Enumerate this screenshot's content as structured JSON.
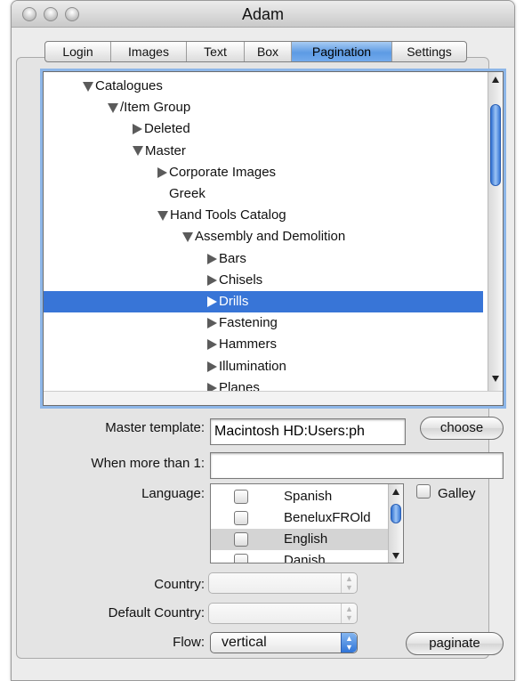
{
  "window": {
    "title": "Adam"
  },
  "tabs": [
    {
      "label": "Login",
      "active": false
    },
    {
      "label": "Images",
      "active": false
    },
    {
      "label": "Text",
      "active": false
    },
    {
      "label": "Box",
      "active": false
    },
    {
      "label": "Pagination",
      "active": true
    },
    {
      "label": "Settings",
      "active": false
    }
  ],
  "tree": {
    "items": [
      {
        "label": "Catalogues",
        "expanded": true,
        "level": 0,
        "has_children": true
      },
      {
        "label": "/Item Group",
        "expanded": true,
        "level": 1,
        "has_children": true
      },
      {
        "label": "Deleted",
        "expanded": false,
        "level": 2,
        "has_children": true
      },
      {
        "label": "Master",
        "expanded": true,
        "level": 2,
        "has_children": true
      },
      {
        "label": "Corporate Images",
        "expanded": false,
        "level": 3,
        "has_children": true
      },
      {
        "label": "Greek",
        "expanded": false,
        "level": 3,
        "has_children": false
      },
      {
        "label": "Hand Tools Catalog",
        "expanded": true,
        "level": 3,
        "has_children": true
      },
      {
        "label": "Assembly and Demolition",
        "expanded": true,
        "level": 4,
        "has_children": true
      },
      {
        "label": "Bars",
        "expanded": false,
        "level": 5,
        "has_children": true
      },
      {
        "label": "Chisels",
        "expanded": false,
        "level": 5,
        "has_children": true
      },
      {
        "label": "Drills",
        "expanded": false,
        "level": 5,
        "has_children": true,
        "selected": true
      },
      {
        "label": "Fastening",
        "expanded": false,
        "level": 5,
        "has_children": true
      },
      {
        "label": "Hammers",
        "expanded": false,
        "level": 5,
        "has_children": true
      },
      {
        "label": "Illumination",
        "expanded": false,
        "level": 5,
        "has_children": true
      },
      {
        "label": "Planes",
        "expanded": false,
        "level": 5,
        "has_children": true
      }
    ]
  },
  "form": {
    "master_template": {
      "label": "Master template:",
      "value": "Macintosh HD:Users:ph",
      "button": "choose"
    },
    "when_more_than": {
      "label": "When more than 1:",
      "value": ""
    },
    "language": {
      "label": "Language:",
      "options": [
        {
          "label": "Spanish",
          "checked": false,
          "selected": false
        },
        {
          "label": "BeneluxFROld",
          "checked": false,
          "selected": false
        },
        {
          "label": "English",
          "checked": false,
          "selected": true
        },
        {
          "label": "Danish",
          "checked": false,
          "selected": false
        }
      ],
      "galley_label": "Galley",
      "galley_checked": false
    },
    "country": {
      "label": "Country:",
      "value": ""
    },
    "default_country": {
      "label": "Default Country:",
      "value": ""
    },
    "flow": {
      "label": "Flow:",
      "value": "vertical"
    },
    "paginate_button": "paginate"
  },
  "colors": {
    "selection": "#3875d7",
    "focus_ring": "#8db6e8",
    "active_tab": "#5d9be4",
    "window_bg": "#ececec"
  }
}
